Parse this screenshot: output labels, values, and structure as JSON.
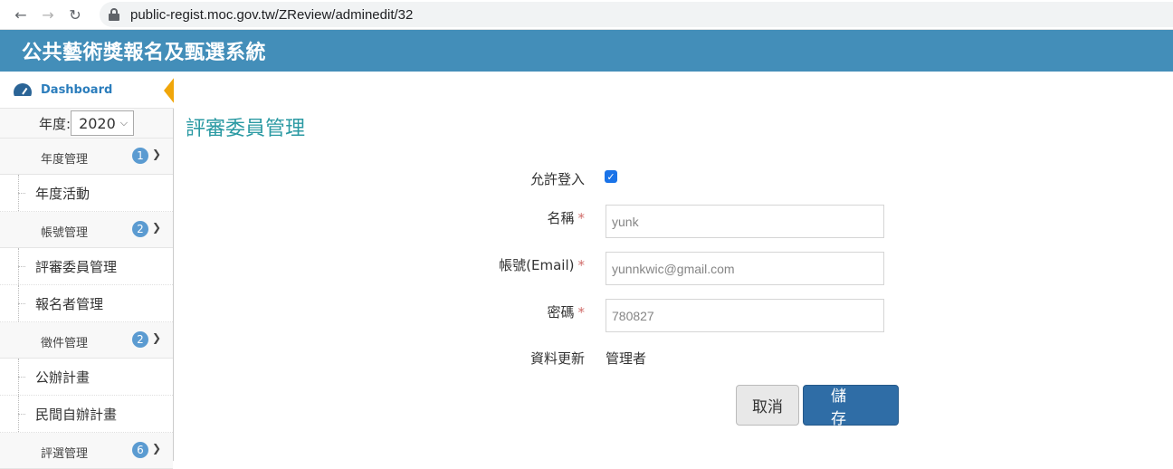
{
  "browser": {
    "back_icon": "←",
    "forward_icon": "→",
    "reload_icon": "↻",
    "url": "public-regist.moc.gov.tw/ZReview/adminedit/32"
  },
  "header": {
    "title": "公共藝術獎報名及甄選系統"
  },
  "sidebar": {
    "dashboard_label": "Dashboard",
    "year_label": "年度:",
    "year_value": "2020",
    "groups": [
      {
        "label": "年度管理",
        "badge": "1",
        "items": [
          "年度活動"
        ]
      },
      {
        "label": "帳號管理",
        "badge": "2",
        "items": [
          "評審委員管理",
          "報名者管理"
        ]
      },
      {
        "label": "徵件管理",
        "badge": "2",
        "items": [
          "公辦計畫",
          "民間自辦計畫"
        ]
      },
      {
        "label": "評選管理",
        "badge": "6",
        "items": []
      }
    ]
  },
  "main": {
    "title": "評審委員管理",
    "form": {
      "allow_login_label": "允許登入",
      "name_label": "名稱",
      "name_value": "yunk",
      "account_label": "帳號(Email)",
      "account_value": "yunnkwic@gmail.com",
      "password_label": "密碼",
      "password_value": "780827",
      "updated_label": "資料更新",
      "updated_value": "管理者",
      "required_mark": "*",
      "check_mark": "✓"
    },
    "buttons": {
      "cancel": "取消",
      "save": "儲存"
    }
  },
  "colors": {
    "header": "#438eb9",
    "accent": "#2b7dbc",
    "title": "#2b9aa3",
    "save": "#2f6da6"
  }
}
